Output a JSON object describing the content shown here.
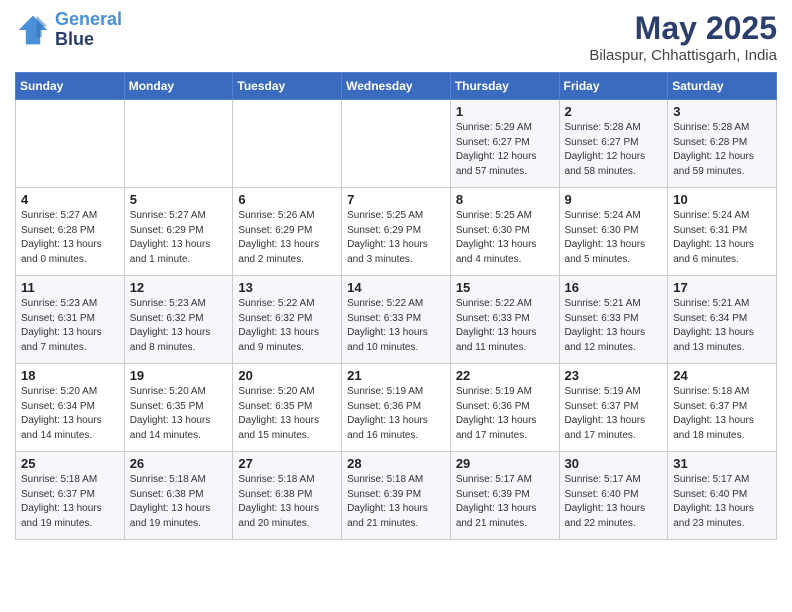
{
  "header": {
    "logo_line1": "General",
    "logo_line2": "Blue",
    "month": "May 2025",
    "location": "Bilaspur, Chhattisgarh, India"
  },
  "weekdays": [
    "Sunday",
    "Monday",
    "Tuesday",
    "Wednesday",
    "Thursday",
    "Friday",
    "Saturday"
  ],
  "weeks": [
    [
      {
        "day": "",
        "info": ""
      },
      {
        "day": "",
        "info": ""
      },
      {
        "day": "",
        "info": ""
      },
      {
        "day": "",
        "info": ""
      },
      {
        "day": "1",
        "info": "Sunrise: 5:29 AM\nSunset: 6:27 PM\nDaylight: 12 hours\nand 57 minutes."
      },
      {
        "day": "2",
        "info": "Sunrise: 5:28 AM\nSunset: 6:27 PM\nDaylight: 12 hours\nand 58 minutes."
      },
      {
        "day": "3",
        "info": "Sunrise: 5:28 AM\nSunset: 6:28 PM\nDaylight: 12 hours\nand 59 minutes."
      }
    ],
    [
      {
        "day": "4",
        "info": "Sunrise: 5:27 AM\nSunset: 6:28 PM\nDaylight: 13 hours\nand 0 minutes."
      },
      {
        "day": "5",
        "info": "Sunrise: 5:27 AM\nSunset: 6:29 PM\nDaylight: 13 hours\nand 1 minute."
      },
      {
        "day": "6",
        "info": "Sunrise: 5:26 AM\nSunset: 6:29 PM\nDaylight: 13 hours\nand 2 minutes."
      },
      {
        "day": "7",
        "info": "Sunrise: 5:25 AM\nSunset: 6:29 PM\nDaylight: 13 hours\nand 3 minutes."
      },
      {
        "day": "8",
        "info": "Sunrise: 5:25 AM\nSunset: 6:30 PM\nDaylight: 13 hours\nand 4 minutes."
      },
      {
        "day": "9",
        "info": "Sunrise: 5:24 AM\nSunset: 6:30 PM\nDaylight: 13 hours\nand 5 minutes."
      },
      {
        "day": "10",
        "info": "Sunrise: 5:24 AM\nSunset: 6:31 PM\nDaylight: 13 hours\nand 6 minutes."
      }
    ],
    [
      {
        "day": "11",
        "info": "Sunrise: 5:23 AM\nSunset: 6:31 PM\nDaylight: 13 hours\nand 7 minutes."
      },
      {
        "day": "12",
        "info": "Sunrise: 5:23 AM\nSunset: 6:32 PM\nDaylight: 13 hours\nand 8 minutes."
      },
      {
        "day": "13",
        "info": "Sunrise: 5:22 AM\nSunset: 6:32 PM\nDaylight: 13 hours\nand 9 minutes."
      },
      {
        "day": "14",
        "info": "Sunrise: 5:22 AM\nSunset: 6:33 PM\nDaylight: 13 hours\nand 10 minutes."
      },
      {
        "day": "15",
        "info": "Sunrise: 5:22 AM\nSunset: 6:33 PM\nDaylight: 13 hours\nand 11 minutes."
      },
      {
        "day": "16",
        "info": "Sunrise: 5:21 AM\nSunset: 6:33 PM\nDaylight: 13 hours\nand 12 minutes."
      },
      {
        "day": "17",
        "info": "Sunrise: 5:21 AM\nSunset: 6:34 PM\nDaylight: 13 hours\nand 13 minutes."
      }
    ],
    [
      {
        "day": "18",
        "info": "Sunrise: 5:20 AM\nSunset: 6:34 PM\nDaylight: 13 hours\nand 14 minutes."
      },
      {
        "day": "19",
        "info": "Sunrise: 5:20 AM\nSunset: 6:35 PM\nDaylight: 13 hours\nand 14 minutes."
      },
      {
        "day": "20",
        "info": "Sunrise: 5:20 AM\nSunset: 6:35 PM\nDaylight: 13 hours\nand 15 minutes."
      },
      {
        "day": "21",
        "info": "Sunrise: 5:19 AM\nSunset: 6:36 PM\nDaylight: 13 hours\nand 16 minutes."
      },
      {
        "day": "22",
        "info": "Sunrise: 5:19 AM\nSunset: 6:36 PM\nDaylight: 13 hours\nand 17 minutes."
      },
      {
        "day": "23",
        "info": "Sunrise: 5:19 AM\nSunset: 6:37 PM\nDaylight: 13 hours\nand 17 minutes."
      },
      {
        "day": "24",
        "info": "Sunrise: 5:18 AM\nSunset: 6:37 PM\nDaylight: 13 hours\nand 18 minutes."
      }
    ],
    [
      {
        "day": "25",
        "info": "Sunrise: 5:18 AM\nSunset: 6:37 PM\nDaylight: 13 hours\nand 19 minutes."
      },
      {
        "day": "26",
        "info": "Sunrise: 5:18 AM\nSunset: 6:38 PM\nDaylight: 13 hours\nand 19 minutes."
      },
      {
        "day": "27",
        "info": "Sunrise: 5:18 AM\nSunset: 6:38 PM\nDaylight: 13 hours\nand 20 minutes."
      },
      {
        "day": "28",
        "info": "Sunrise: 5:18 AM\nSunset: 6:39 PM\nDaylight: 13 hours\nand 21 minutes."
      },
      {
        "day": "29",
        "info": "Sunrise: 5:17 AM\nSunset: 6:39 PM\nDaylight: 13 hours\nand 21 minutes."
      },
      {
        "day": "30",
        "info": "Sunrise: 5:17 AM\nSunset: 6:40 PM\nDaylight: 13 hours\nand 22 minutes."
      },
      {
        "day": "31",
        "info": "Sunrise: 5:17 AM\nSunset: 6:40 PM\nDaylight: 13 hours\nand 23 minutes."
      }
    ]
  ]
}
